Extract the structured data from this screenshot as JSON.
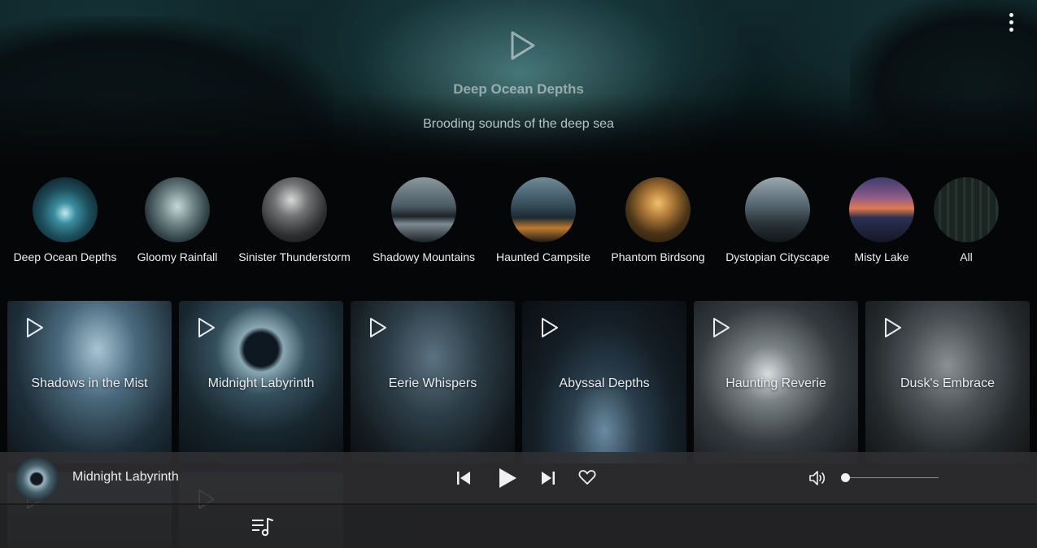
{
  "hero": {
    "title": "Deep Ocean Depths",
    "subtitle": "Brooding sounds of the deep sea",
    "play_icon": "play-icon",
    "menu_icon": "more-vertical-icon"
  },
  "categories": [
    {
      "label": "Deep Ocean Depths",
      "color": "#2a6f80"
    },
    {
      "label": "Gloomy Rainfall",
      "color": "#51676d"
    },
    {
      "label": "Sinister Thunderstorm",
      "color": "#4e5153"
    },
    {
      "label": "Shadowy Mountains",
      "color": "#5f6a70"
    },
    {
      "label": "Haunted Campsite",
      "color": "#3d5a68"
    },
    {
      "label": "Phantom Birdsong",
      "color": "#8a6a3c"
    },
    {
      "label": "Dystopian Cityscape",
      "color": "#5a6872"
    },
    {
      "label": "Misty Lake",
      "color": "#7a5870"
    },
    {
      "label": "All",
      "color": "#2c3a32"
    }
  ],
  "cards": [
    {
      "title": "Shadows in the Mist",
      "color": "#3c5a6e"
    },
    {
      "title": "Midnight Labyrinth",
      "color": "#4a6470"
    },
    {
      "title": "Eerie Whispers",
      "color": "#344650"
    },
    {
      "title": "Abyssal Depths",
      "color": "#2e4656"
    },
    {
      "title": "Haunting Reverie",
      "color": "#474f54"
    },
    {
      "title": "Dusk's Embrace",
      "color": "#3e4244"
    }
  ],
  "player": {
    "now_playing": "Midnight Labyrinth",
    "prev_icon": "skip-previous-icon",
    "play_icon": "play-icon",
    "next_icon": "skip-next-icon",
    "favorite_icon": "heart-icon",
    "volume_icon": "volume-icon",
    "volume_level": 0.0,
    "queue_icon": "queue-music-icon"
  },
  "colors": {
    "background": "#050607",
    "player_bar": "#303032",
    "text": "#f0f0f0"
  }
}
